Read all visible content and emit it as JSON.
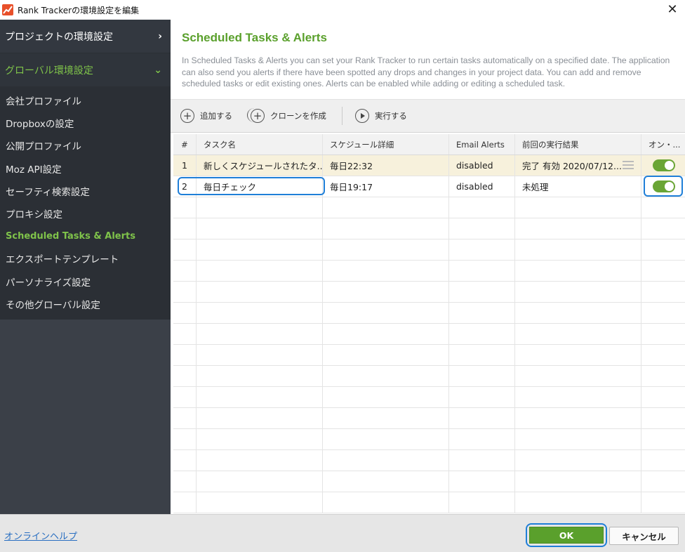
{
  "window": {
    "title": "Rank Trackerの環境設定を編集",
    "close_glyph": "✕"
  },
  "sidebar": {
    "project_settings": "プロジェクトの環境設定",
    "global_settings": "グローバル環境設定",
    "items": [
      {
        "label": "会社プロファイル"
      },
      {
        "label": "Dropboxの設定"
      },
      {
        "label": "公開プロファイル"
      },
      {
        "label": "Moz API設定"
      },
      {
        "label": "セーフティ検索設定"
      },
      {
        "label": "プロキシ設定"
      },
      {
        "label": "Scheduled Tasks & Alerts"
      },
      {
        "label": "エクスポートテンプレート"
      },
      {
        "label": "パーソナライズ設定"
      },
      {
        "label": "その他グローバル設定"
      }
    ]
  },
  "main": {
    "title": "Scheduled Tasks & Alerts",
    "description": "In Scheduled Tasks & Alerts you can set your Rank Tracker to run certain tasks automatically on a specified date. The application can also send you alerts if there have been spotted any drops and changes in your project data. You can add and remove scheduled tasks or edit existing ones. Alerts can be enabled while adding or editing a scheduled task.",
    "toolbar": {
      "add": "追加する",
      "clone": "クローンを作成",
      "run": "実行する"
    },
    "table": {
      "headers": [
        "#",
        "タスク名",
        "スケジュール詳細",
        "Email Alerts",
        "前回の実行結果",
        "オン・..."
      ],
      "rows": [
        {
          "num": "1",
          "name": "新しくスケジュールされたタ...",
          "schedule": "毎日22:32",
          "alerts": "disabled",
          "last": "完了 有効 2020/07/12...",
          "enabled": true
        },
        {
          "num": "2",
          "name": "毎日チェック",
          "schedule": "毎日19:17",
          "alerts": "disabled",
          "last": "未処理",
          "enabled": true
        }
      ]
    }
  },
  "footer": {
    "help": "オンラインヘルプ",
    "ok": "OK",
    "cancel": "キャンセル"
  },
  "colors": {
    "accent": "#5aa02c",
    "sidebar": "#3b4048",
    "highlight": "#1f7fd8"
  }
}
